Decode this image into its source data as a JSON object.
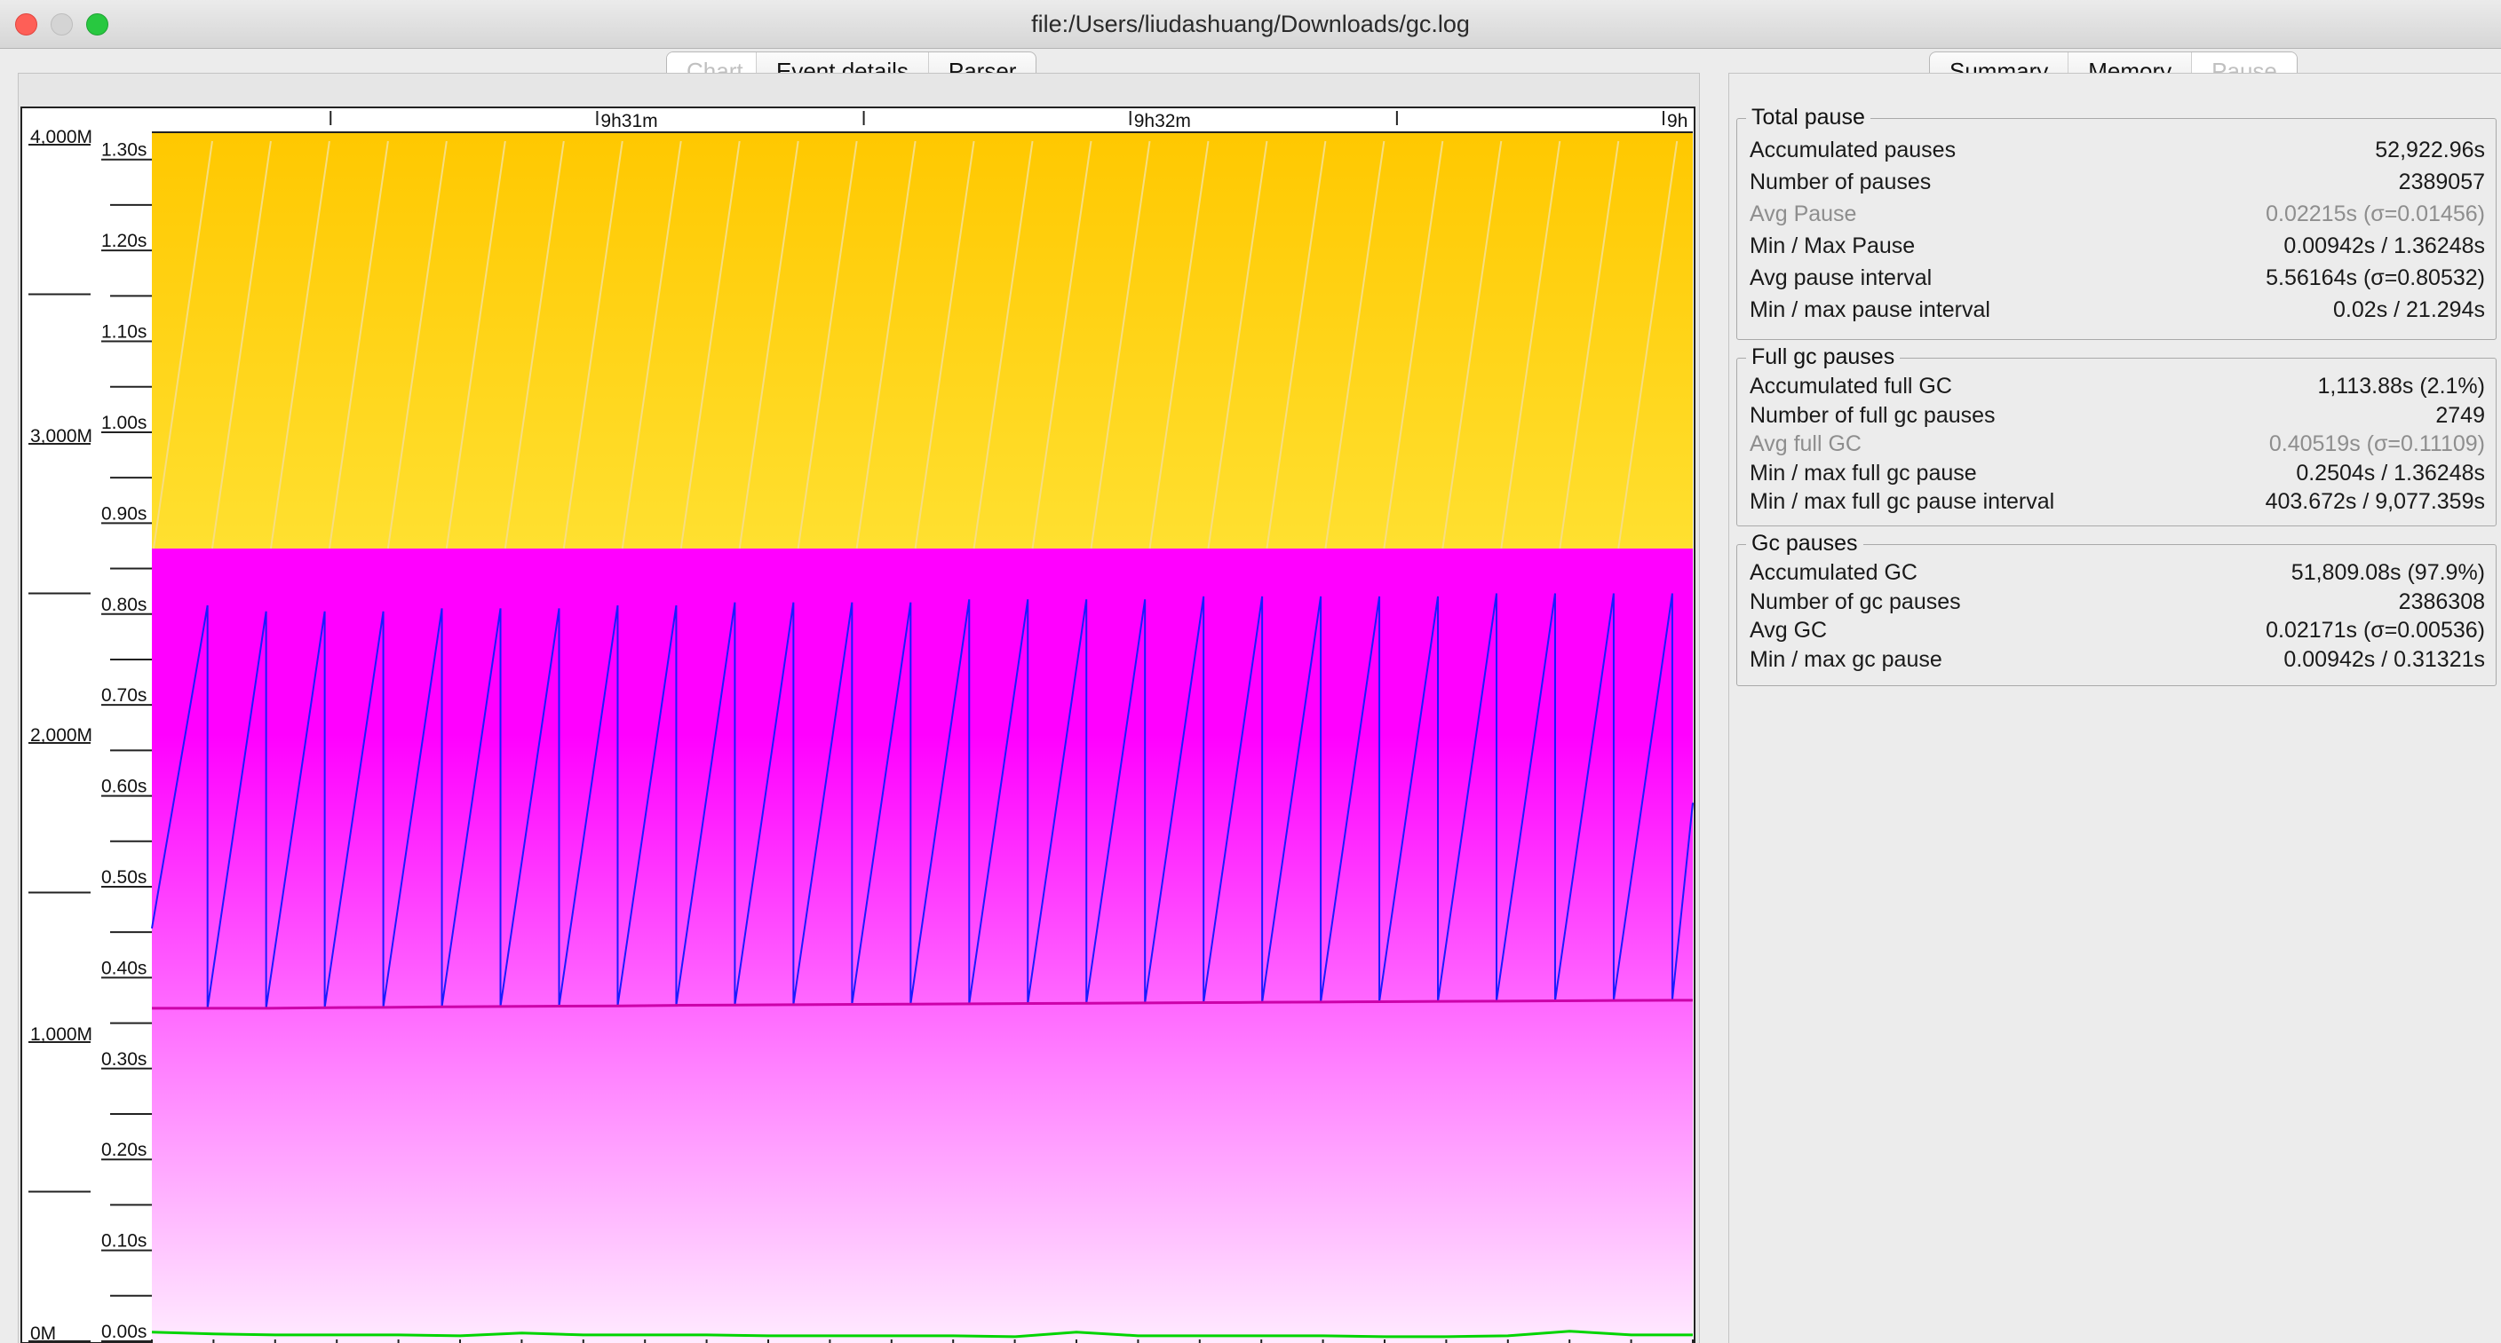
{
  "window": {
    "title": "file:/Users/liudashuang/Downloads/gc.log"
  },
  "left_tabs": [
    {
      "label": "Chart",
      "selected": true
    },
    {
      "label": "Event details",
      "selected": false
    },
    {
      "label": "Parser",
      "selected": false
    }
  ],
  "right_tabs": [
    {
      "label": "Summary",
      "selected": false
    },
    {
      "label": "Memory",
      "selected": false
    },
    {
      "label": "Pause",
      "selected": true
    }
  ],
  "colors": {
    "heap_total": "#ffc800",
    "heap_used_fill": "#ff00ff",
    "used_line": "#1a1aff",
    "tenured_line": "#cc00aa",
    "pause_line": "#00d400",
    "panel_bg": "#ececec"
  },
  "chart_data": {
    "type": "area",
    "x_ticks": [
      {
        "label": "",
        "pos": 0.116
      },
      {
        "label": "9h31m",
        "pos": 0.289
      },
      {
        "label": "",
        "pos": 0.462
      },
      {
        "label": "9h32m",
        "pos": 0.635
      },
      {
        "label": "",
        "pos": 0.808
      },
      {
        "label": "9h",
        "pos": 0.981
      }
    ],
    "memory_axis": {
      "labels": [
        "4,000M",
        "3,000M",
        "2,000M",
        "1,000M",
        "0M"
      ],
      "values": [
        4000,
        3000,
        2000,
        1000,
        0
      ],
      "range": [
        0,
        4000
      ]
    },
    "pause_axis": {
      "labels": [
        "1.30s",
        "1.20s",
        "1.10s",
        "1.00s",
        "0.90s",
        "0.80s",
        "0.70s",
        "0.60s",
        "0.50s",
        "0.40s",
        "0.30s",
        "0.20s",
        "0.10s",
        "0.00s"
      ],
      "values": [
        1.3,
        1.2,
        1.1,
        1.0,
        0.9,
        0.8,
        0.7,
        0.6,
        0.5,
        0.4,
        0.3,
        0.2,
        0.1,
        0.0
      ],
      "range": [
        0,
        1.33
      ]
    },
    "series": [
      {
        "name": "total heap",
        "kind": "area",
        "value_mb": 4000
      },
      {
        "name": "young region boundary",
        "kind": "area",
        "value_mb": 2650
      },
      {
        "name": "used heap",
        "kind": "sawtooth",
        "peaks_mb": [
          2460,
          2440,
          2440,
          2440,
          2450,
          2450,
          2450,
          2460,
          2460,
          2470,
          2470,
          2470,
          2470,
          2480,
          2480,
          2480,
          2480,
          2490,
          2490,
          2490,
          2490,
          2490,
          2500,
          2500,
          2500,
          2500
        ],
        "troughs_mb": [
          1113,
          1113,
          1115,
          1116,
          1118,
          1119,
          1120,
          1121,
          1123,
          1124,
          1125,
          1126,
          1127,
          1128,
          1129,
          1130,
          1131,
          1132,
          1133,
          1134,
          1135,
          1136,
          1137,
          1138,
          1139,
          1140
        ]
      },
      {
        "name": "gc pause",
        "kind": "line",
        "values_s": [
          0.01,
          0.008,
          0.007,
          0.007,
          0.007,
          0.006,
          0.009,
          0.007,
          0.007,
          0.007,
          0.006,
          0.006,
          0.006,
          0.006,
          0.005,
          0.01,
          0.006,
          0.006,
          0.006,
          0.006,
          0.005,
          0.005,
          0.006,
          0.011,
          0.007,
          0.007
        ]
      }
    ]
  },
  "stats": {
    "total_pause": {
      "title": "Total pause",
      "rows": [
        {
          "label": "Accumulated pauses",
          "value": "52,922.96s",
          "muted": false
        },
        {
          "label": "Number of pauses",
          "value": "2389057",
          "muted": false
        },
        {
          "label": "Avg Pause",
          "value": "0.02215s (σ=0.01456)",
          "muted": true
        },
        {
          "label": "Min / Max Pause",
          "value": "0.00942s / 1.36248s",
          "muted": false
        },
        {
          "label": "Avg pause interval",
          "value": "5.56164s (σ=0.80532)",
          "muted": false
        },
        {
          "label": "Min / max pause interval",
          "value": "0.02s / 21.294s",
          "muted": false
        }
      ]
    },
    "full_gc": {
      "title": "Full gc pauses",
      "rows": [
        {
          "label": "Accumulated full GC",
          "value": "1,113.88s (2.1%)",
          "muted": false
        },
        {
          "label": "Number of full gc pauses",
          "value": "2749",
          "muted": false
        },
        {
          "label": "Avg full GC",
          "value": "0.40519s (σ=0.11109)",
          "muted": true
        },
        {
          "label": "Min / max full gc pause",
          "value": "0.2504s / 1.36248s",
          "muted": false
        },
        {
          "label": "Min / max full gc pause interval",
          "value": "403.672s / 9,077.359s",
          "muted": false
        }
      ]
    },
    "gc": {
      "title": "Gc pauses",
      "rows": [
        {
          "label": "Accumulated GC",
          "value": "51,809.08s (97.9%)",
          "muted": false
        },
        {
          "label": "Number of gc pauses",
          "value": "2386308",
          "muted": false
        },
        {
          "label": "Avg GC",
          "value": "0.02171s (σ=0.00536)",
          "muted": false
        },
        {
          "label": "Min / max gc pause",
          "value": "0.00942s / 0.31321s",
          "muted": false
        }
      ]
    }
  }
}
